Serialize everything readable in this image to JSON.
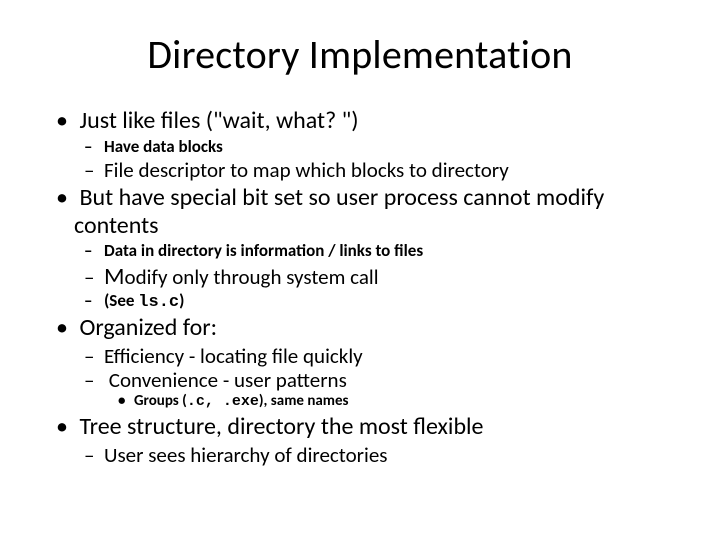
{
  "title": "Directory Implementation",
  "b1": "Just like files (\"wait, what? \")",
  "b1s1": "Have data blocks",
  "b1s2": "File descriptor to map which blocks to directory",
  "b2": "But have special bit set so user process cannot modify contents",
  "b2s1": "Data in directory is information / links to files",
  "b2s2_m": "M",
  "b2s2_rest": "odify only through system call",
  "b2s3_pre": "(See ",
  "b2s3_code": "ls.c",
  "b2s3_post": ")",
  "b3": "Organized for:",
  "b3s1": "Efficiency - locating file quickly",
  "b3s2": "Convenience - user patterns",
  "b3s2_t1_pre": "Groups (",
  "b3s2_t1_code": ".c, .exe",
  "b3s2_t1_post": "), same names",
  "b4": "Tree structure, directory the most flexible",
  "b4s1": "User sees hierarchy of directories"
}
